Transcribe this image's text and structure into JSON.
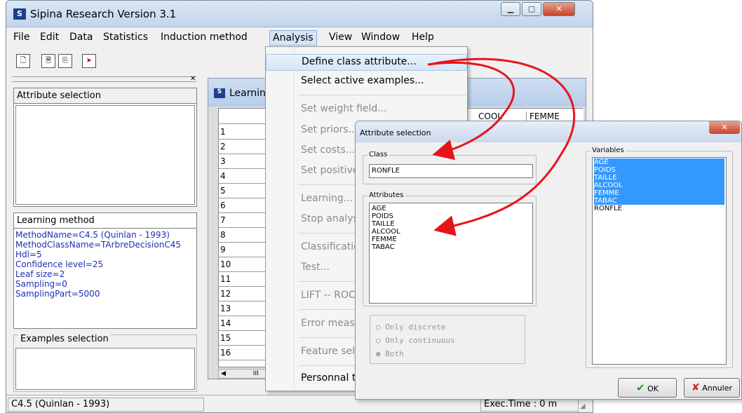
{
  "app": {
    "title": "Sipina Research Version 3.1",
    "icon": "sipina-app-icon"
  },
  "menubar": [
    "File",
    "Edit",
    "Data",
    "Statistics",
    "Induction method",
    "Analysis",
    "View",
    "Window",
    "Help"
  ],
  "left": {
    "attr_title": "Attribute selection",
    "method_title": "Learning method",
    "method_lines": [
      "MethodName=C4.5 (Quinlan - 1993)",
      "MethodClassName=TArbreDecisionC45",
      "Hdl=5",
      "Confidence level=25",
      "Leaf size=2",
      "Sampling=0",
      "SamplingPart=5000"
    ],
    "examples_title": "Examples selection"
  },
  "learning_window": {
    "title": "Learnin",
    "col_alcool": "COOL",
    "col_femme": "FEMME",
    "rows": [
      "1",
      "2",
      "3",
      "4",
      "5",
      "6",
      "7",
      "8",
      "9",
      "10",
      "11",
      "12",
      "13",
      "14",
      "15",
      "16"
    ],
    "scroll_glyph": "III"
  },
  "status": {
    "left": "C4.5 (Quinlan - 1993)",
    "right": "Exec.Time : 0 m"
  },
  "analysis_menu": [
    {
      "label": "Define class attribute...",
      "disabled": false
    },
    {
      "label": "Select active examples...",
      "disabled": false
    },
    {
      "label": "Set weight field...",
      "disabled": true
    },
    {
      "label": "Set priors...",
      "disabled": true
    },
    {
      "label": "Set costs...",
      "disabled": true
    },
    {
      "label": "Set positive",
      "disabled": true
    },
    {
      "label": "Learning...",
      "disabled": true
    },
    {
      "label": "Stop analys",
      "disabled": true
    },
    {
      "label": "Classificatio",
      "disabled": true
    },
    {
      "label": "Test...",
      "disabled": true
    },
    {
      "label": "LIFT -- ROC",
      "disabled": true
    },
    {
      "label": "Error measu",
      "disabled": true
    },
    {
      "label": "Feature sele",
      "disabled": true
    },
    {
      "label": "Personnal t",
      "disabled": false
    }
  ],
  "dialog": {
    "title": "Attribute selection",
    "class_label": "Class",
    "class_value": "RONFLE",
    "attributes_label": "Attributes",
    "attributes": [
      "AGE",
      "POIDS",
      "TAILLE",
      "ALCOOL",
      "FEMME",
      "TABAC"
    ],
    "variables_label": "Variables",
    "variables": [
      {
        "name": "AGE",
        "selected": true
      },
      {
        "name": "POIDS",
        "selected": true
      },
      {
        "name": "TAILLE",
        "selected": true
      },
      {
        "name": "ALCOOL",
        "selected": true
      },
      {
        "name": "FEMME",
        "selected": true
      },
      {
        "name": "TABAC",
        "selected": true
      },
      {
        "name": "RONFLE",
        "selected": false
      }
    ],
    "radios": [
      {
        "label": "Only discrete",
        "checked": false
      },
      {
        "label": "Only continuous",
        "checked": false
      },
      {
        "label": "Both",
        "checked": true
      }
    ],
    "ok": "OK",
    "cancel": "Annuler"
  },
  "colors": {
    "arrow": "#e8141b",
    "selection": "#3399ff",
    "method_text": "#1c2fb0"
  }
}
